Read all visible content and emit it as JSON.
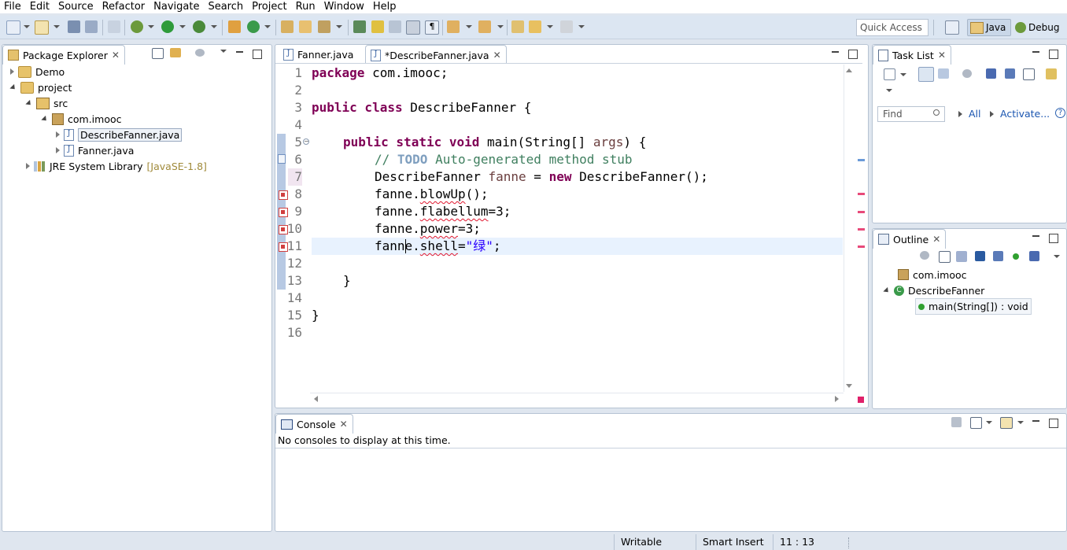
{
  "menu": [
    "File",
    "Edit",
    "Source",
    "Refactor",
    "Navigate",
    "Search",
    "Project",
    "Run",
    "Window",
    "Help"
  ],
  "toolbar": {
    "quick_access_placeholder": "Quick Access",
    "perspectives": [
      {
        "label": "Java",
        "active": true
      },
      {
        "label": "Debug",
        "active": false
      }
    ]
  },
  "package_explorer": {
    "title": "Package Explorer",
    "tree": [
      {
        "label": "Demo",
        "level": 0,
        "expanded": false,
        "icon": "project-folder-icon"
      },
      {
        "label": "project",
        "level": 0,
        "expanded": true,
        "icon": "project-folder-icon"
      },
      {
        "label": "src",
        "level": 1,
        "expanded": true,
        "icon": "source-folder-icon"
      },
      {
        "label": "com.imooc",
        "level": 2,
        "expanded": true,
        "icon": "package-icon"
      },
      {
        "label": "DescribeFanner.java",
        "level": 3,
        "expanded": false,
        "icon": "java-file-icon",
        "selected": true
      },
      {
        "label": "Fanner.java",
        "level": 3,
        "expanded": false,
        "icon": "java-file-icon"
      },
      {
        "label": "JRE System Library",
        "suffix": "[JavaSE-1.8]",
        "level": 1,
        "expanded": false,
        "icon": "library-icon"
      }
    ]
  },
  "editor": {
    "tabs": [
      {
        "label": "Fanner.java",
        "active": false
      },
      {
        "label": "*DescribeFanner.java",
        "active": true
      }
    ],
    "line_numbers": [
      "1",
      "2",
      "3",
      "4",
      "5",
      "6",
      "7",
      "8",
      "9",
      "10",
      "11",
      "12",
      "13",
      "14",
      "15",
      "16"
    ],
    "code": {
      "l1_kw": "package",
      "l1_rest": " com.imooc;",
      "l3_kw": "public class",
      "l3_rest": " DescribeFanner {",
      "l5_kw": "public static void",
      "l5_mid": " main(String[] ",
      "l5_var": "args",
      "l5_end": ") {",
      "l6_cm": "// ",
      "l6_todo": "TODO",
      "l6_cm2": " Auto-generated method stub",
      "l7_a": "DescribeFanner ",
      "l7_var": "fanne",
      "l7_b": " = ",
      "l7_kw": "new",
      "l7_c": " DescribeFanner();",
      "l8_a": "fanne.",
      "l8_err": "blowUp",
      "l8_b": "();",
      "l9_a": "fanne.",
      "l9_err": "flabellum",
      "l9_b": "=3;",
      "l10_a": "fanne.",
      "l10_err": "power",
      "l10_b": "=3;",
      "l11_a": "fanne.",
      "l11_err": "shell",
      "l11_b": "=",
      "l11_str": "\"绿\"",
      "l11_c": ";",
      "l13": "}",
      "l15": "}"
    },
    "error_lines": [
      8,
      9,
      10,
      11
    ],
    "current_line": 11
  },
  "task_list": {
    "title": "Task List",
    "find_placeholder": "Find",
    "all_label": "All",
    "activate_label": "Activate..."
  },
  "outline": {
    "title": "Outline",
    "items": [
      {
        "label": "com.imooc",
        "icon": "package-icon"
      },
      {
        "label": "DescribeFanner",
        "icon": "class-icon"
      },
      {
        "label": "main(String[]) : void",
        "icon": "method-icon"
      }
    ]
  },
  "console": {
    "title": "Console",
    "message": "No consoles to display at this time."
  },
  "status": {
    "writable": "Writable",
    "insert_mode": "Smart Insert",
    "position": "11 : 13"
  }
}
